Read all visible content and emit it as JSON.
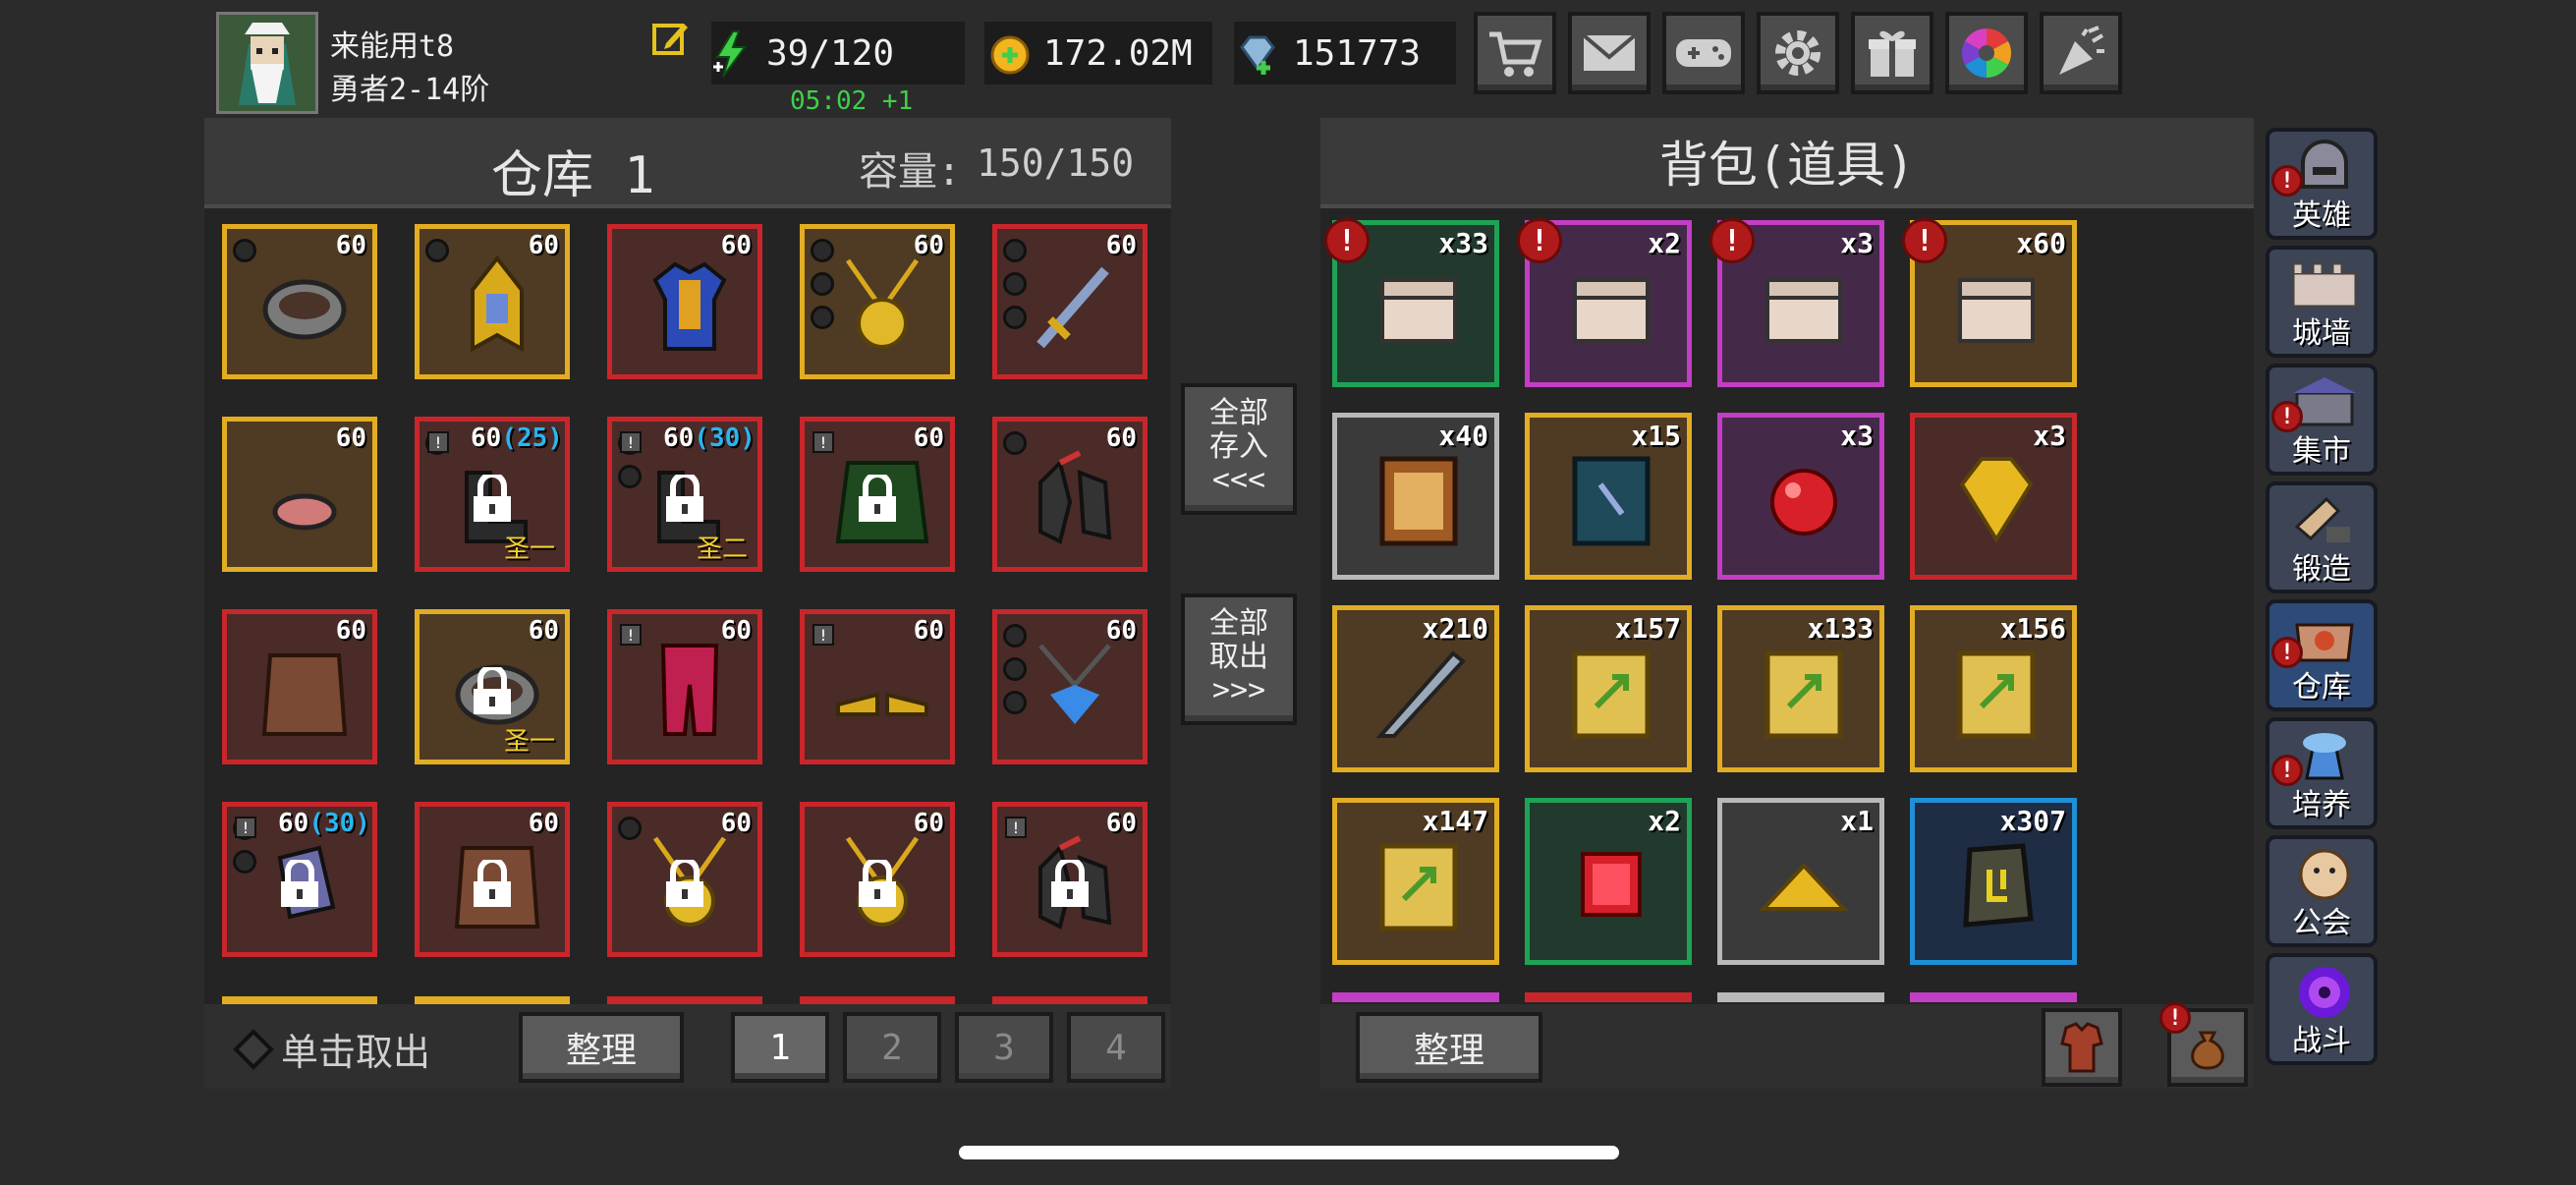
{
  "player": {
    "name": "来能用t8",
    "rank": "勇者2-14阶"
  },
  "stats": {
    "energy": "39/120",
    "energy_timer": "05:02 +1",
    "gold": "172.02M",
    "gems": "151773"
  },
  "top_icons": [
    "cart-icon",
    "mail-icon",
    "gamepad-icon",
    "gear-icon",
    "gift-icon",
    "color-wheel-icon",
    "confetti-icon"
  ],
  "warehouse": {
    "title": "仓库 1",
    "capacity_label": "容量:",
    "capacity": "150/150",
    "slots": [
      {
        "lvl": "60",
        "rarity": "gold"
      },
      {
        "lvl": "60",
        "rarity": "gold"
      },
      {
        "lvl": "60",
        "rarity": "red"
      },
      {
        "lvl": "60",
        "rarity": "gold"
      },
      {
        "lvl": "60",
        "rarity": "red"
      },
      {
        "lvl": "60",
        "rarity": "gold"
      },
      {
        "lvl": "60",
        "extra": "(25)",
        "rarity": "red",
        "tag": "圣一"
      },
      {
        "lvl": "60",
        "extra": "(30)",
        "rarity": "red",
        "tag": "圣二"
      },
      {
        "lvl": "60",
        "rarity": "red"
      },
      {
        "lvl": "60",
        "rarity": "red"
      },
      {
        "lvl": "60",
        "rarity": "red"
      },
      {
        "lvl": "60",
        "rarity": "gold",
        "tag": "圣一"
      },
      {
        "lvl": "60",
        "rarity": "red"
      },
      {
        "lvl": "60",
        "rarity": "red"
      },
      {
        "lvl": "60",
        "rarity": "red"
      },
      {
        "lvl": "60",
        "extra": "(30)",
        "rarity": "red"
      },
      {
        "lvl": "60",
        "rarity": "red"
      },
      {
        "lvl": "60",
        "rarity": "red"
      },
      {
        "lvl": "60",
        "rarity": "red"
      },
      {
        "lvl": "60",
        "rarity": "red"
      }
    ],
    "withdraw_toggle": "单击取出",
    "sort": "整理",
    "pages": [
      "1",
      "2",
      "3",
      "4"
    ]
  },
  "transfer": {
    "deposit_all": "全部\n存入\n<<<",
    "withdraw_all": "全部\n取出\n>>>"
  },
  "bag": {
    "title": "背包(道具)",
    "sort": "整理",
    "slots": [
      {
        "count": "x33",
        "rarity": "green"
      },
      {
        "count": "x2",
        "rarity": "purple"
      },
      {
        "count": "x3",
        "rarity": "purple"
      },
      {
        "count": "x60",
        "rarity": "gold"
      },
      {
        "count": "x40",
        "rarity": "gray"
      },
      {
        "count": "x15",
        "rarity": "gold"
      },
      {
        "count": "x3",
        "rarity": "purple"
      },
      {
        "count": "x3",
        "rarity": "red"
      },
      {
        "count": "x210",
        "rarity": "gold"
      },
      {
        "count": "x157",
        "rarity": "gold"
      },
      {
        "count": "x133",
        "rarity": "gold"
      },
      {
        "count": "x156",
        "rarity": "gold"
      },
      {
        "count": "x147",
        "rarity": "gold"
      },
      {
        "count": "x2",
        "rarity": "green"
      },
      {
        "count": "x1",
        "rarity": "gray"
      },
      {
        "count": "x307",
        "rarity": "blue"
      }
    ]
  },
  "nav": [
    "英雄",
    "城墙",
    "集市",
    "锻造",
    "仓库",
    "培养",
    "公会",
    "战斗"
  ],
  "colors": {
    "gold": "#e2ad22",
    "red": "#c9262b",
    "purple": "#c23ec4",
    "green": "#1ea356",
    "gray": "#b8b8b8",
    "blue": "#1f8fd6",
    "extra_text": "#29b6f0",
    "timer": "#3fd04a",
    "tag": "#f4cf2c"
  }
}
